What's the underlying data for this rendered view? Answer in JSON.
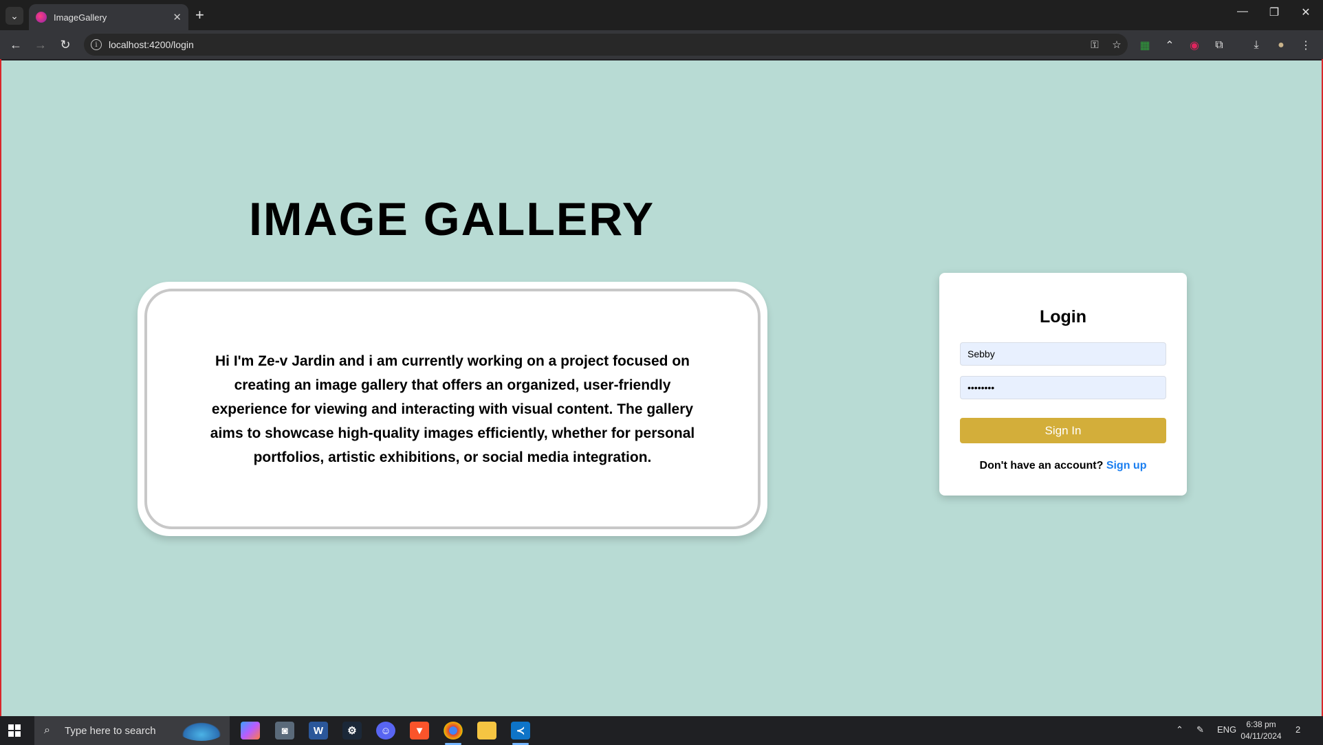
{
  "browser": {
    "tab_title": "ImageGallery",
    "url": "localhost:4200/login"
  },
  "page": {
    "headline": "IMAGE GALLERY",
    "about_text": "Hi I'm Ze-v Jardin and i am currently working on a project focused on creating an image gallery that offers an organized, user-friendly experience for viewing and interacting with visual content. The gallery aims to showcase high-quality images efficiently, whether for personal portfolios, artistic exhibitions, or social media integration.",
    "login": {
      "title": "Login",
      "username_value": "Sebby",
      "password_value": "••••••••",
      "signin_label": "Sign In",
      "no_account_text": "Don't have an account?",
      "signup_label": "Sign up"
    }
  },
  "taskbar": {
    "search_placeholder": "Type here to search",
    "language": "ENG",
    "time": "6:38 pm",
    "date": "04/11/2024",
    "notification_count": "2"
  },
  "colors": {
    "page_background": "#b8dbd4",
    "signin_button": "#d3ae3a",
    "signup_link": "#1a7ef0"
  }
}
